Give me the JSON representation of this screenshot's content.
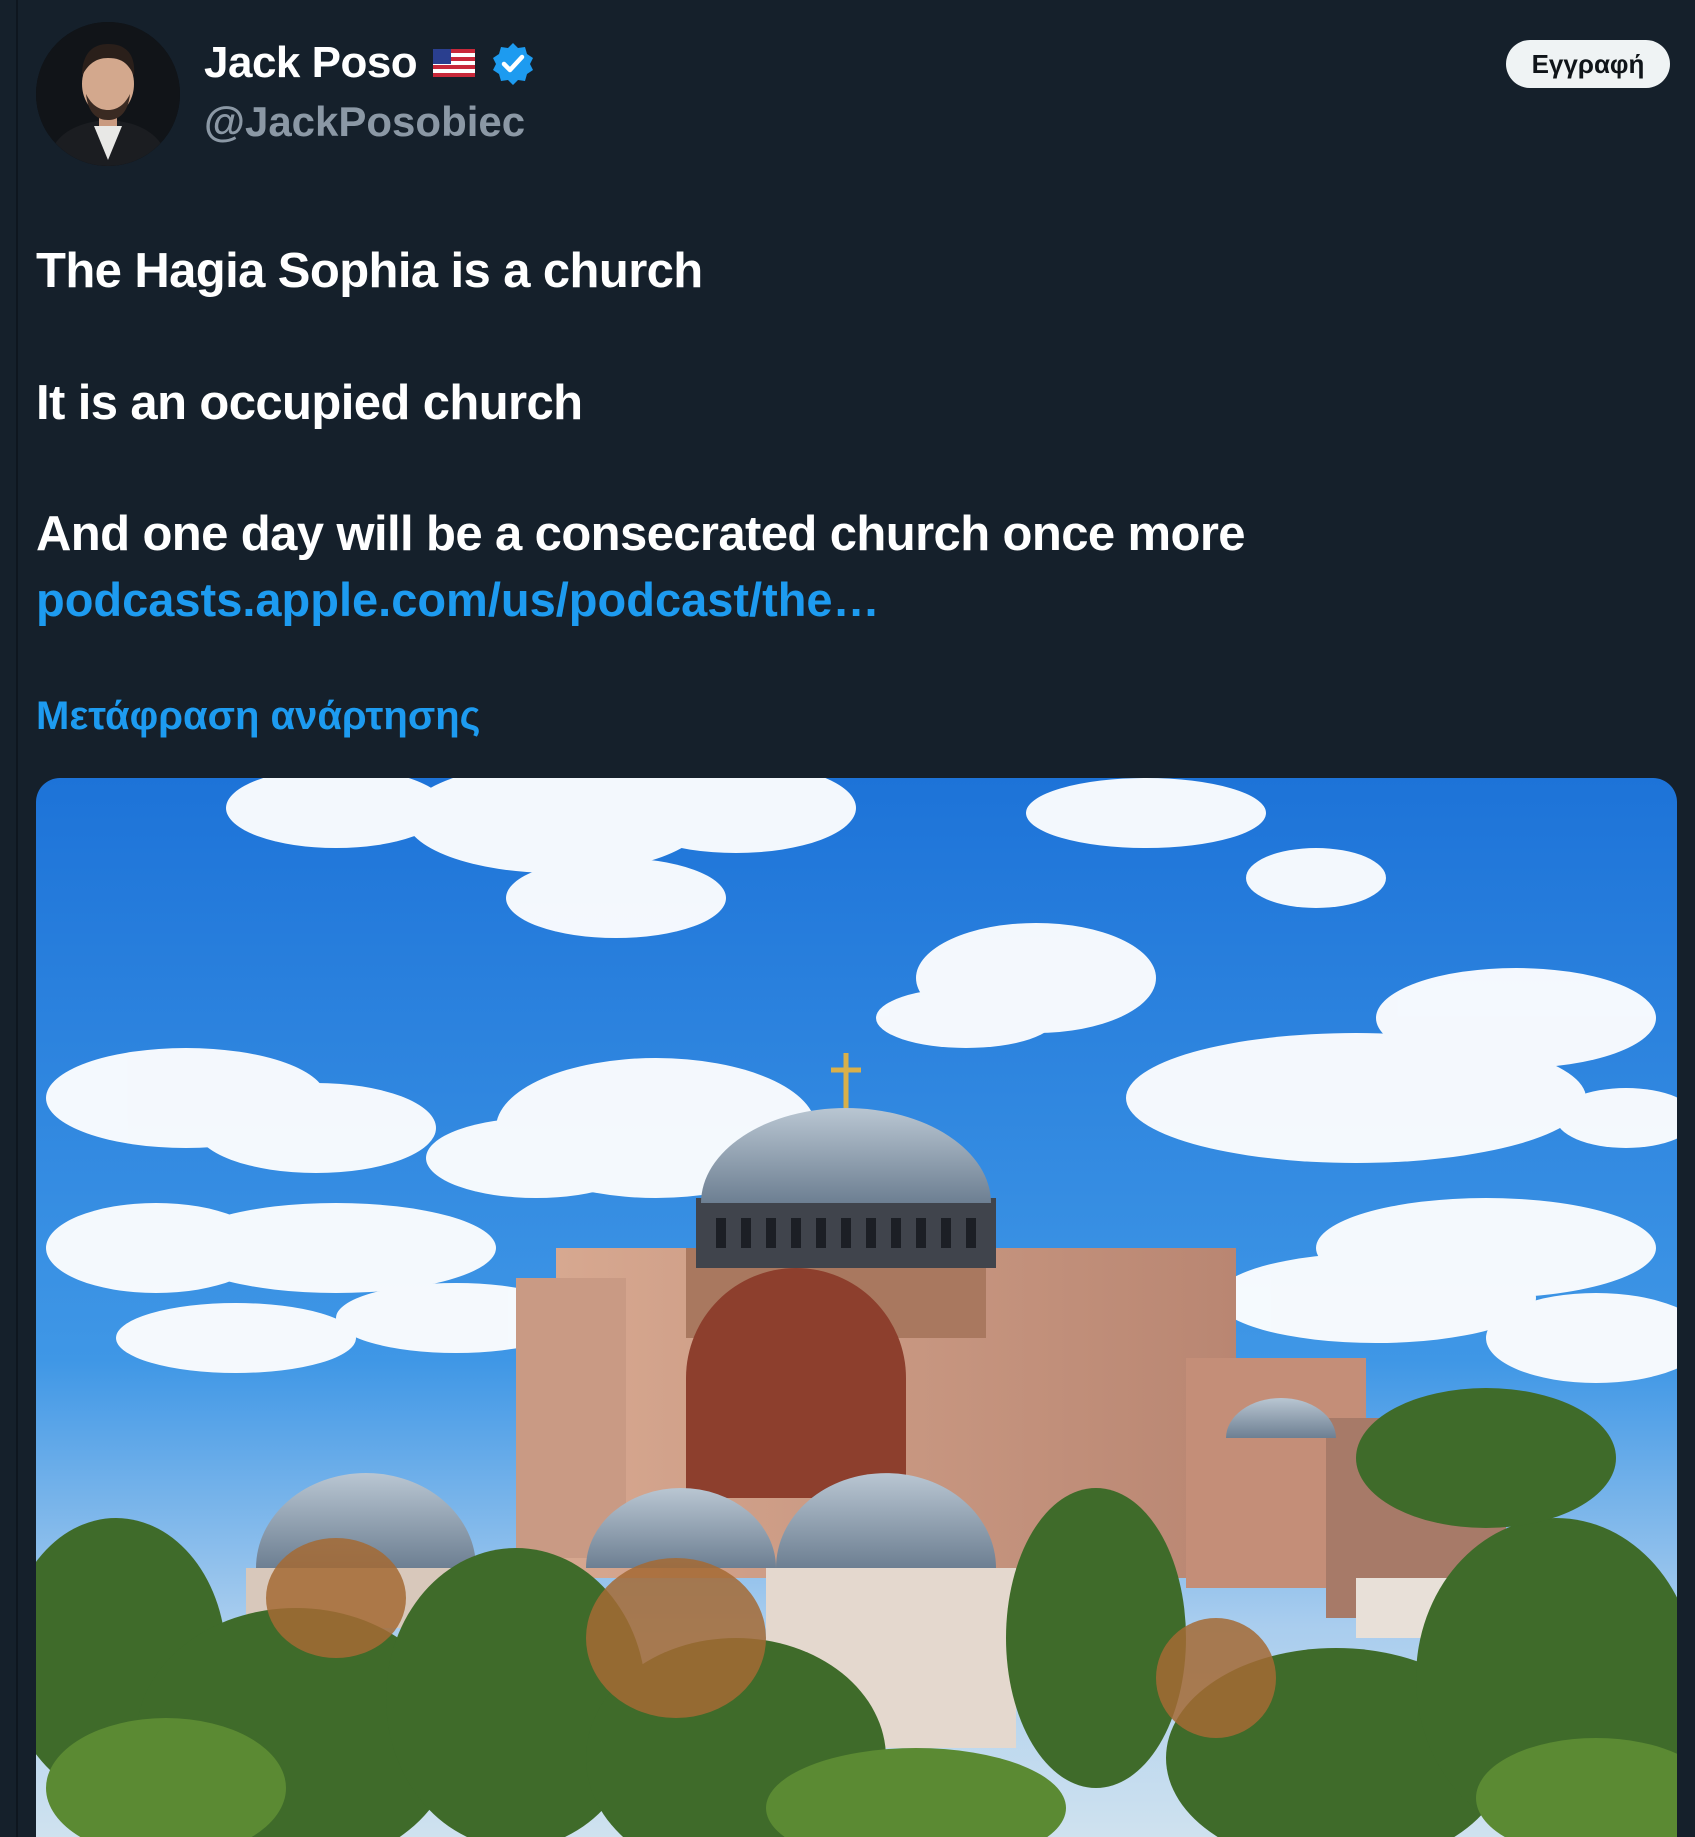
{
  "author": {
    "display_name": "Jack Poso",
    "handle": "@JackPosobiec",
    "flag_icon": "us-flag-icon",
    "verified_icon": "verified-badge-icon",
    "verified_color": "#1d9bf0"
  },
  "follow_button": {
    "label": "Εγγραφή"
  },
  "post": {
    "lines": [
      "The Hagia Sophia is a church",
      "It is an occupied church",
      "And one day will be a consecrated church once more"
    ],
    "link": "podcasts.apple.com/us/podcast/the…",
    "translate_label": "Μετάφραση ανάρτησης"
  },
  "colors": {
    "background": "#15202b",
    "accent": "#1d9bf0",
    "primary_text": "#ffffff",
    "secondary_text": "#8b98a5"
  }
}
